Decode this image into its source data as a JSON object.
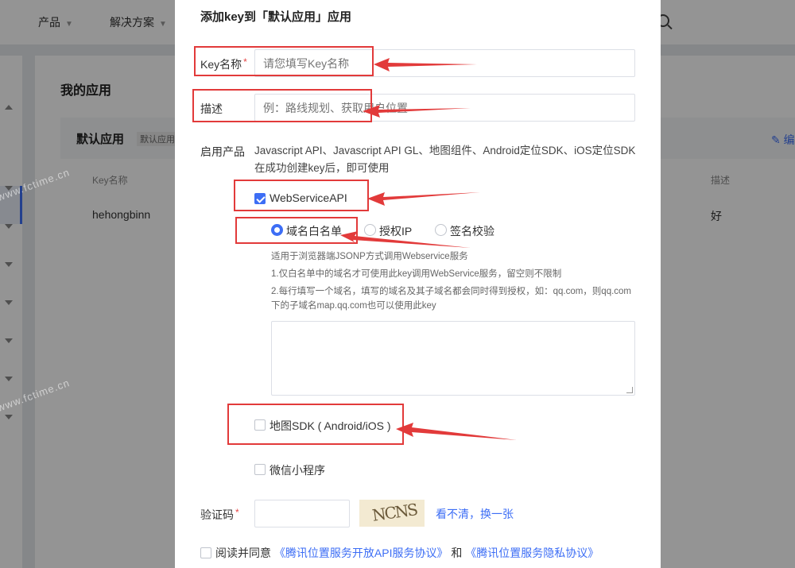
{
  "topnav": {
    "items": [
      "产品",
      "解决方案"
    ]
  },
  "background": {
    "page_title": "我的应用",
    "card_title": "默认应用",
    "card_badge": "默认应用",
    "edit_label": "编",
    "col_key_name": "Key名称",
    "col_desc": "描述",
    "row_key_name": "hehongbinn",
    "row_desc": "好",
    "watermark": "www.fctime.cn"
  },
  "modal": {
    "title": "添加key到「默认应用」应用",
    "key_name_label": "Key名称",
    "key_name_placeholder": "请您填写Key名称",
    "desc_label": "描述",
    "desc_placeholder": "例：路线规划、获取用户位置",
    "products_label": "启用产品",
    "products_text": "Javascript API、Javascript API GL、地图组件、Android定位SDK、iOS定位SDK在成功创建key后，即可使用",
    "webservice_label": "WebServiceAPI",
    "radio_domain": "域名白名单",
    "radio_ip": "授权IP",
    "radio_sign": "签名校验",
    "note_1": "适用于浏览器端JSONP方式调用Webservice服务",
    "note_2": "1.仅白名单中的域名才可使用此key调用WebService服务，留空则不限制",
    "note_3": "2.每行填写一个域名，填写的域名及其子域名都会同时得到授权，如：qq.com，则qq.com下的子域名map.qq.com也可以使用此key",
    "sdk_label": "地图SDK ( Android/iOS )",
    "miniprogram_label": "微信小程序",
    "captcha_label": "验证码",
    "captcha_text": "NCNS",
    "captcha_refresh": "看不清，换一张",
    "agree_prefix": "阅读并同意",
    "agreement_1": "《腾讯位置服务开放API服务协议》",
    "agree_and": "和",
    "agreement_2": "《腾讯位置服务隐私协议》"
  },
  "colors": {
    "accent": "#3d6ef5",
    "annotation": "#e23a3a",
    "required": "#e54545"
  }
}
